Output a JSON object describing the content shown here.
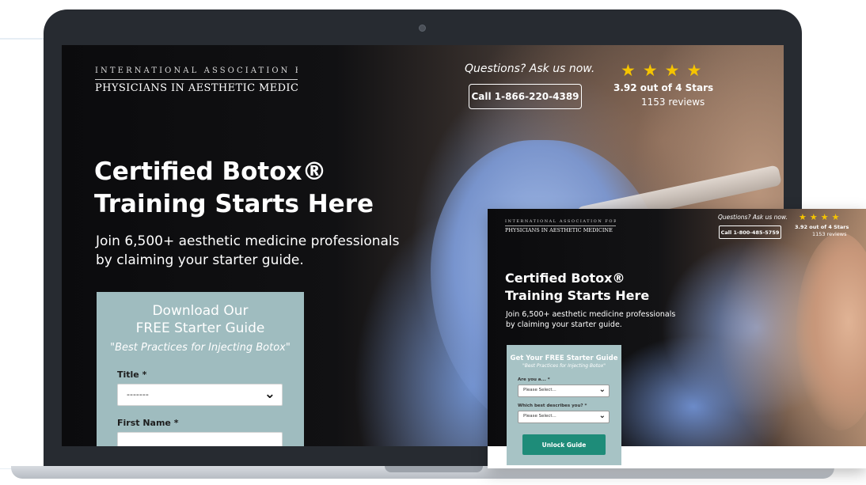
{
  "main_page": {
    "logo": {
      "line1": "INTERNATIONAL ASSOCIATION FOR",
      "line2": "PHYSICIANS IN AESTHETIC MEDICINE"
    },
    "header": {
      "ask_text": "Questions? Ask us now.",
      "call_label": "Call 1-866-220-4389",
      "stars": "★★★★",
      "rating": "3.92 out of 4 Stars",
      "reviews": "1153 reviews"
    },
    "hero": {
      "title": "Certified Botox® Training Starts Here",
      "subtitle": "Join 6,500+ aesthetic medicine professionals by claiming your starter guide."
    },
    "form": {
      "title_line1": "Download Our",
      "title_line2": "FREE Starter Guide",
      "quote": "\"Best Practices for Injecting Botox\"",
      "title_label": "Title *",
      "title_value": "-------",
      "first_name_label": "First Name *",
      "first_name_value": ""
    }
  },
  "mobile_page": {
    "logo": {
      "line1": "INTERNATIONAL ASSOCIATION FOR",
      "line2": "PHYSICIANS IN AESTHETIC MEDICINE"
    },
    "header": {
      "ask_text": "Questions? Ask us now.",
      "call_label": "Call 1-800-485-5759",
      "stars": "★★★★",
      "rating": "3.92 out of 4 Stars",
      "reviews": "1153 reviews"
    },
    "hero": {
      "title": "Certified Botox® Training Starts Here",
      "subtitle": "Join 6,500+ aesthetic medicine professionals by claiming your starter guide."
    },
    "form": {
      "title": "Get Your FREE Starter Guide",
      "quote": "\"Best Practices for Injecting Botox\"",
      "q1_label": "Are you a... *",
      "q1_value": "Please Select...",
      "q2_label": "Which best describes you? *",
      "q2_value": "Please Select...",
      "submit_label": "Unlock Guide"
    }
  },
  "colors": {
    "star": "#f5c400",
    "form_bg": "#9fbcbf",
    "unlock_button": "#1e8c79",
    "laptop_frame": "#272b31"
  }
}
